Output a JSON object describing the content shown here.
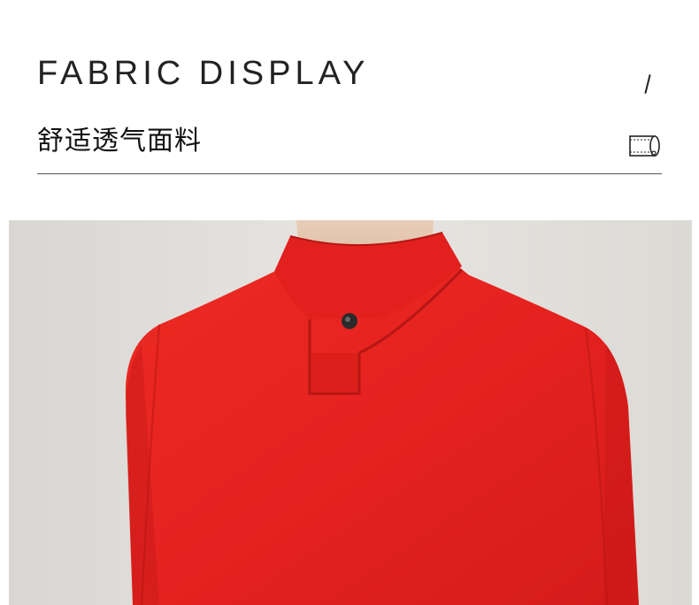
{
  "header": {
    "title_en": "FABRIC DISPLAY",
    "title_cn": "舒适透气面料"
  },
  "icons": {
    "slash": "slash-mark",
    "fabric": "fabric-roll-icon"
  },
  "colors": {
    "garment": "#e5221f",
    "background": "#ffffff",
    "text": "#222222"
  }
}
